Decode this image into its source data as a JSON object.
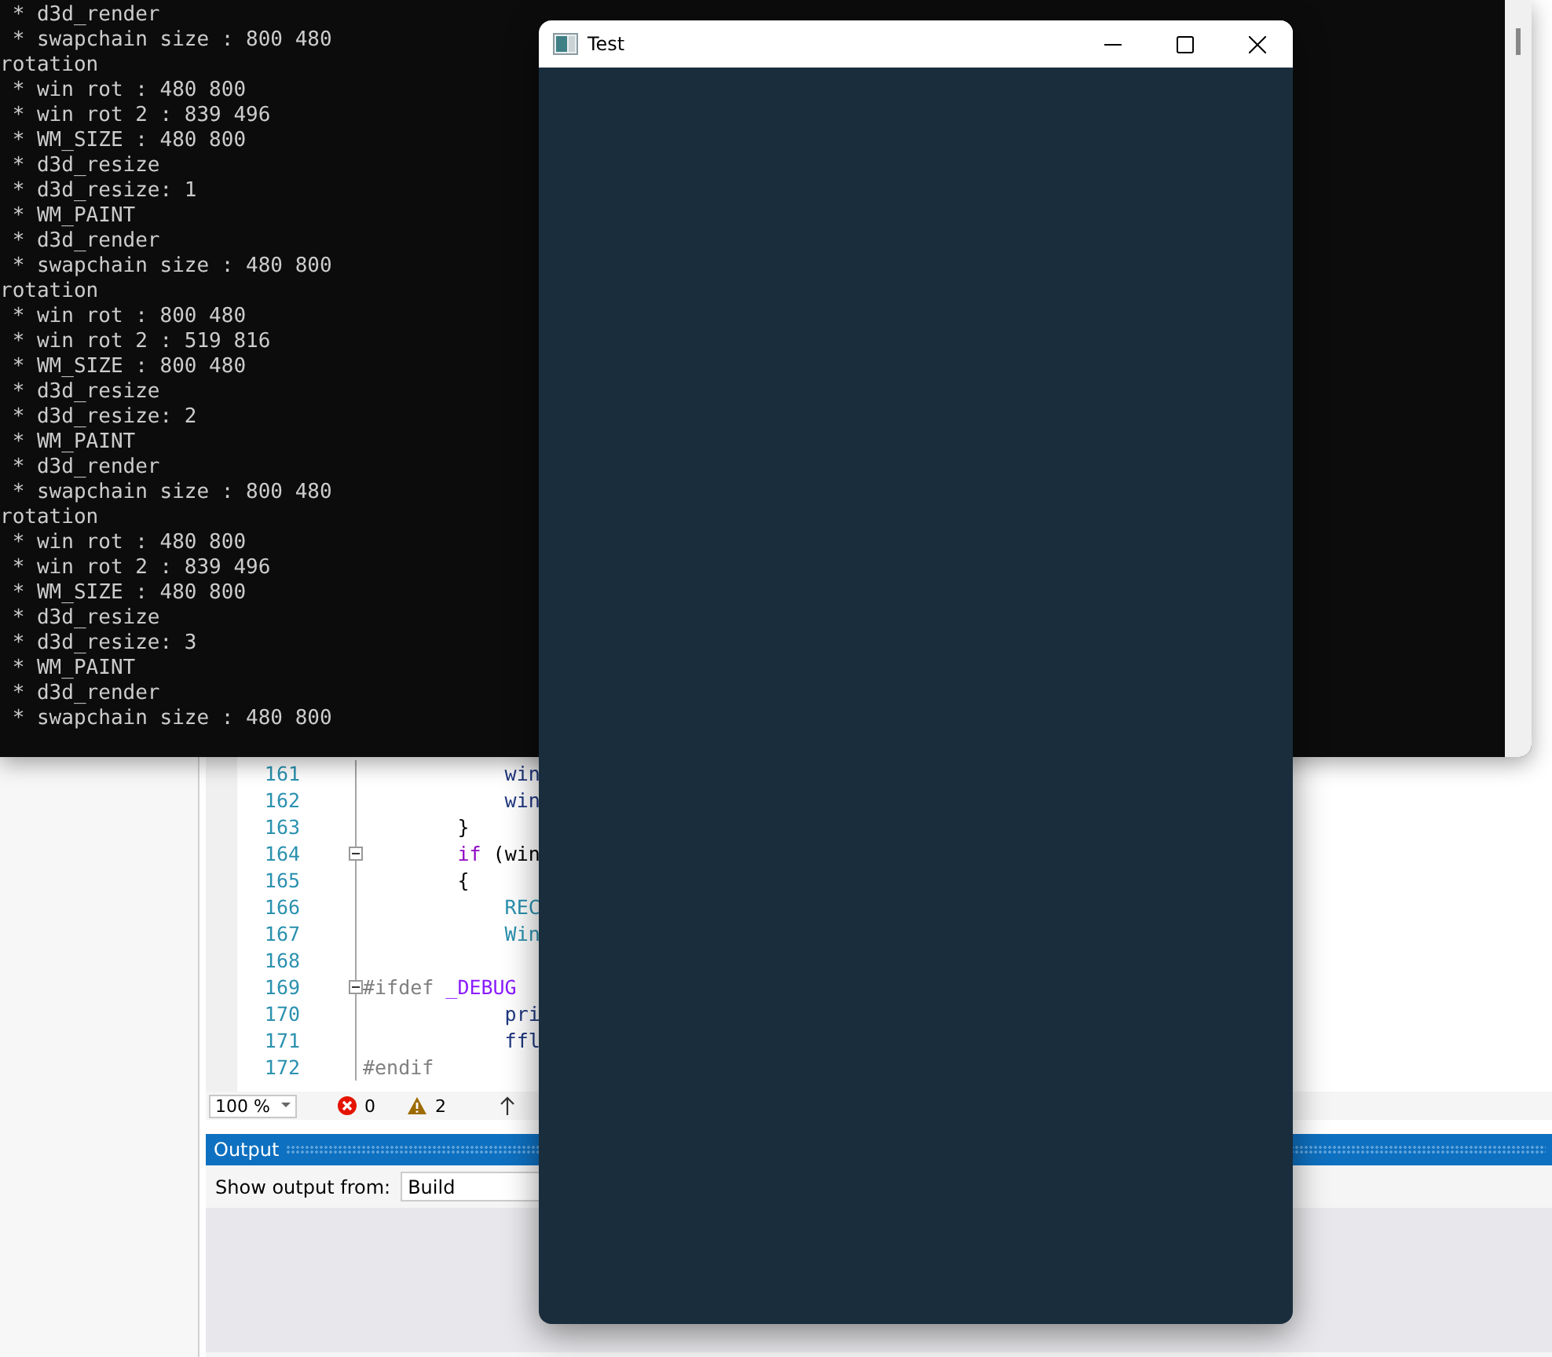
{
  "console": {
    "lines": [
      " * d3d_render",
      " * swapchain size : 800 480",
      "rotation",
      " * win rot : 480 800",
      " * win rot 2 : 839 496",
      " * WM_SIZE : 480 800",
      " * d3d_resize",
      " * d3d_resize: 1",
      " * WM_PAINT",
      " * d3d_render",
      " * swapchain size : 480 800",
      "rotation",
      " * win rot : 800 480",
      " * win rot 2 : 519 816",
      " * WM_SIZE : 800 480",
      " * d3d_resize",
      " * d3d_resize: 2",
      " * WM_PAINT",
      " * d3d_render",
      " * swapchain size : 800 480",
      "rotation",
      " * win rot : 480 800",
      " * win rot 2 : 839 496",
      " * WM_SIZE : 480 800",
      " * d3d_resize",
      " * d3d_resize: 3",
      " * WM_PAINT",
      " * d3d_render",
      " * swapchain size : 480 800"
    ]
  },
  "editor": {
    "lines": [
      {
        "number": "161",
        "fold": false,
        "tokens": [
          {
            "text": "            win",
            "kind": "ident"
          }
        ]
      },
      {
        "number": "162",
        "fold": false,
        "tokens": [
          {
            "text": "            win",
            "kind": "ident"
          }
        ]
      },
      {
        "number": "163",
        "fold": false,
        "tokens": [
          {
            "text": "        }",
            "kind": "plain"
          }
        ]
      },
      {
        "number": "164",
        "fold": true,
        "tokens": [
          {
            "text": "        if",
            "kind": "keyword"
          },
          {
            "text": " (win",
            "kind": "plain"
          }
        ]
      },
      {
        "number": "165",
        "fold": false,
        "tokens": [
          {
            "text": "        {",
            "kind": "plain"
          }
        ]
      },
      {
        "number": "166",
        "fold": false,
        "tokens": [
          {
            "text": "            REC",
            "kind": "type"
          }
        ]
      },
      {
        "number": "167",
        "fold": false,
        "tokens": [
          {
            "text": "            Win",
            "kind": "type"
          }
        ]
      },
      {
        "number": "168",
        "fold": false
      },
      {
        "number": "169",
        "fold": true,
        "tokens": [
          {
            "text": "#ifdef",
            "kind": "preproc"
          },
          {
            "text": " _DEBUG",
            "kind": "macro"
          }
        ]
      },
      {
        "number": "170",
        "fold": false,
        "tokens": [
          {
            "text": "            pri",
            "kind": "ident"
          }
        ]
      },
      {
        "number": "171",
        "fold": false,
        "tokens": [
          {
            "text": "            ffl",
            "kind": "ident"
          }
        ]
      },
      {
        "number": "172",
        "fold": false,
        "tokens": [
          {
            "text": "#endif",
            "kind": "preproc"
          }
        ]
      }
    ],
    "zoom": "100 %",
    "errors": "0",
    "warnings": "2"
  },
  "output": {
    "title": "Output",
    "source_label": "Show output from:",
    "source": "Build"
  },
  "test_window": {
    "title": "Test"
  }
}
